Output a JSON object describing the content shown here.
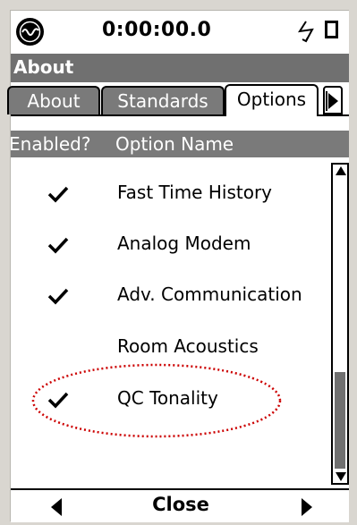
{
  "status": {
    "time": "0:00:00.0"
  },
  "title": "About",
  "tabs": [
    {
      "label": "About",
      "active": false
    },
    {
      "label": "Standards",
      "active": false
    },
    {
      "label": "Options",
      "active": true
    }
  ],
  "columns": {
    "enabled": "Enabled?",
    "name": "Option Name"
  },
  "options": [
    {
      "name": "Fast Time History",
      "enabled": true
    },
    {
      "name": "Analog Modem",
      "enabled": true
    },
    {
      "name": "Adv. Communication",
      "enabled": true
    },
    {
      "name": "Room Acoustics",
      "enabled": false
    },
    {
      "name": "QC Tonality",
      "enabled": true
    }
  ],
  "footer": {
    "close_label": "Close"
  },
  "colors": {
    "header_gray": "#707070",
    "annotation": "#cc0000",
    "background": "#d9d6d0"
  },
  "icons": [
    "app-icon",
    "power-icon",
    "battery-icon",
    "checkmark-icon",
    "scroll-up-icon",
    "scroll-down-icon",
    "nav-left-icon",
    "nav-right-icon",
    "tab-scroll-right-icon"
  ]
}
